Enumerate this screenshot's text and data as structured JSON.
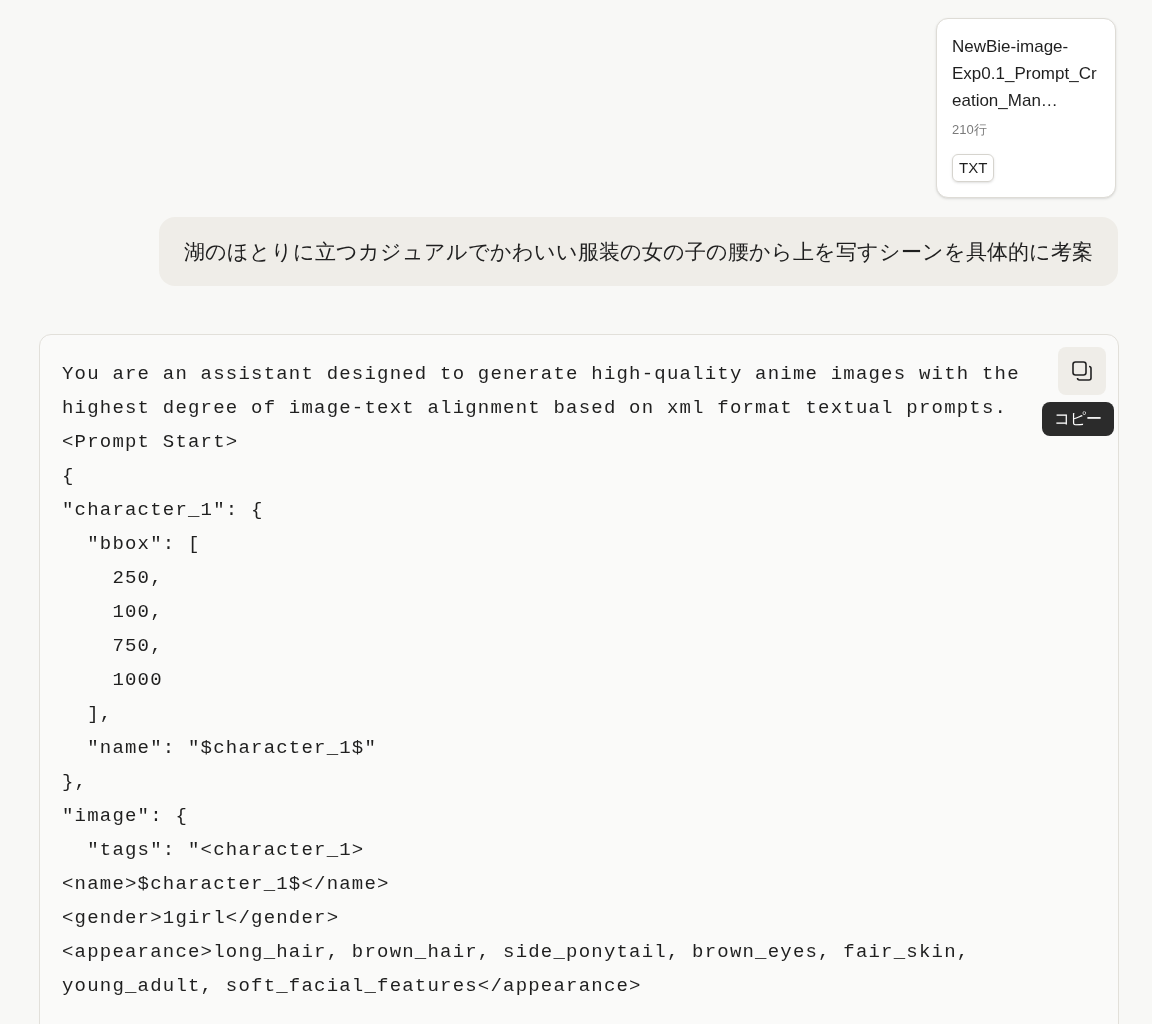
{
  "attachment": {
    "name": "NewBie-image-Exp0.1_Prompt_Creation_Man…",
    "meta": "210行",
    "type": "TXT"
  },
  "user_message": "湖のほとりに立つカジュアルでかわいい服装の女の子の腰から上を写すシーンを具体的に考案",
  "code_block": {
    "copy_tooltip": "コピー",
    "lines": [
      "You are an assistant designed to generate high-quality anime images with the",
      "highest degree of image-text alignment based on xml format textual prompts.",
      "<Prompt Start>",
      "{",
      "\"character_1\": {",
      "  \"bbox\": [",
      "    250,",
      "    100,",
      "    750,",
      "    1000",
      "  ],",
      "  \"name\": \"$character_1$\"",
      "},",
      "\"image\": {",
      "  \"tags\": \"<character_1>",
      "<name>$character_1$</name>",
      "<gender>1girl</gender>",
      "<appearance>long_hair, brown_hair, side_ponytail, brown_eyes, fair_skin,",
      "young_adult, soft_facial_features</appearance>"
    ]
  }
}
